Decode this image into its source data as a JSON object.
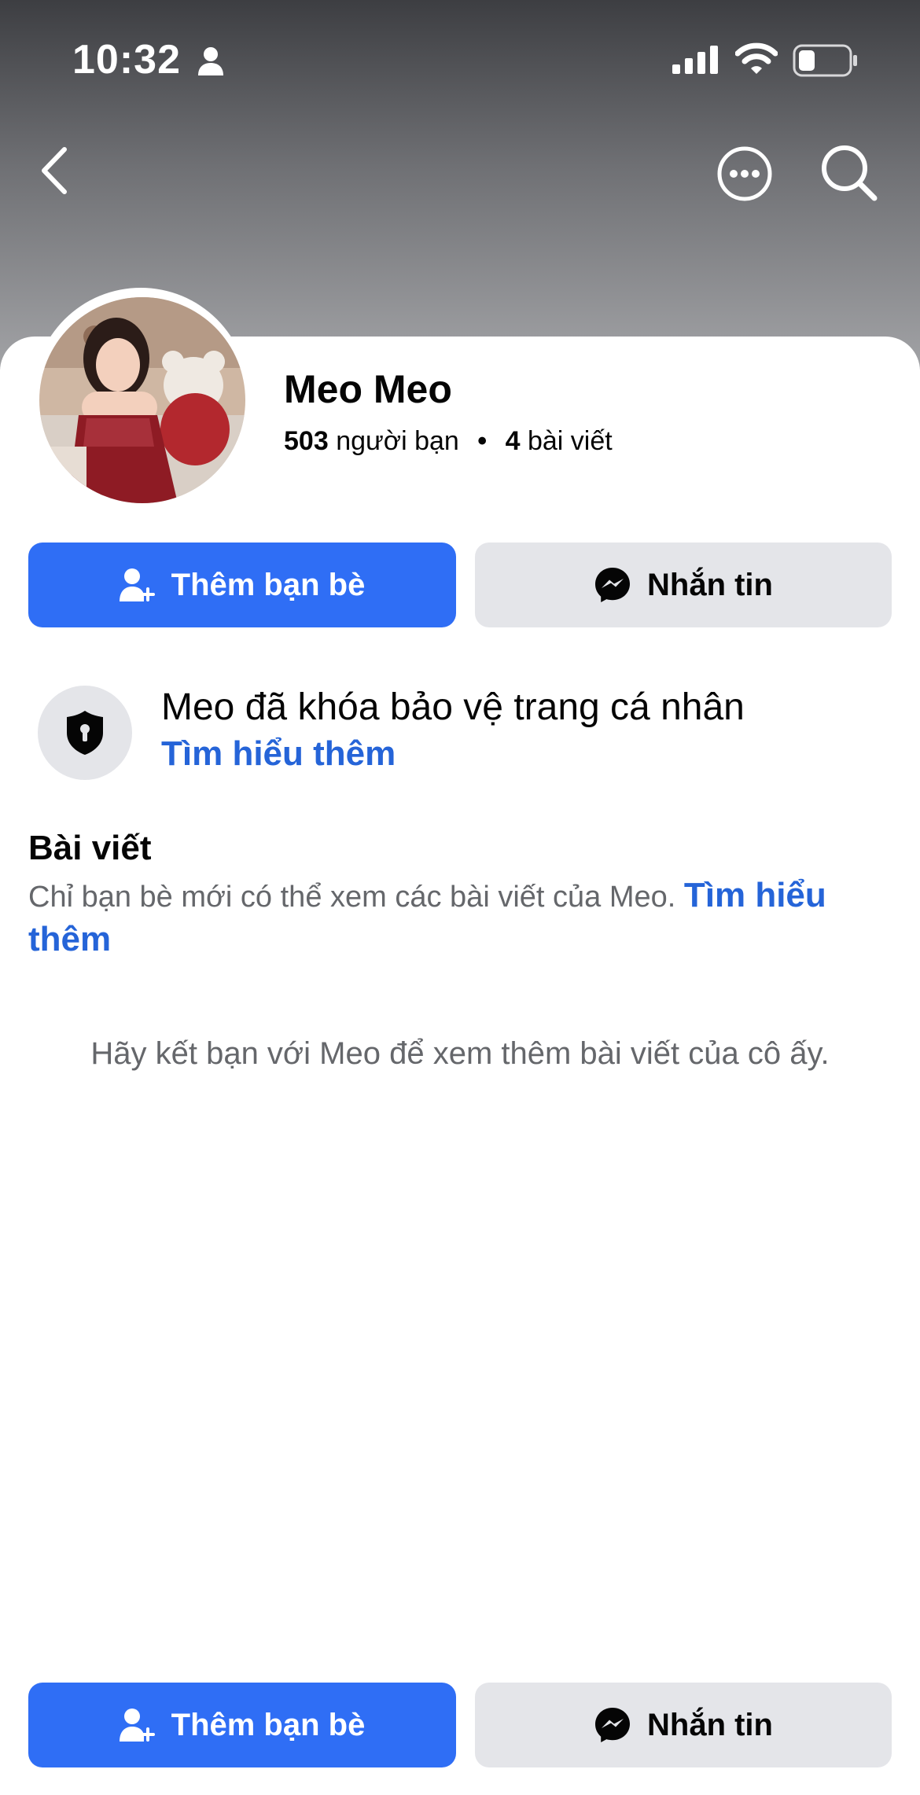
{
  "status_bar": {
    "time": "10:32",
    "icons": [
      "person-icon",
      "cellular-signal-icon",
      "wifi-icon",
      "battery-icon"
    ]
  },
  "nav": {
    "back_icon": "chevron-left-icon",
    "more_icon": "more-options-icon",
    "search_icon": "search-icon"
  },
  "profile": {
    "name": "Meo Meo",
    "friends_count": "503",
    "friends_label": "người bạn",
    "separator": "•",
    "posts_count": "4",
    "posts_label": "bài viết"
  },
  "actions": {
    "add_friend_label": "Thêm bạn bè",
    "message_label": "Nhắn tin"
  },
  "lock_notice": {
    "title": "Meo đã khóa bảo vệ trang cá nhân",
    "link": "Tìm hiểu thêm"
  },
  "posts_section": {
    "heading": "Bài viết",
    "description": "Chỉ bạn bè mới có thể xem các bài viết của Meo.",
    "link": "Tìm hiểu thêm",
    "empty_message": "Hãy kết bạn với Meo để xem thêm bài viết của cô ấy."
  },
  "colors": {
    "primary_blue": "#2f6ef5",
    "link_blue": "#2564d8",
    "secondary_gray": "#e4e5e9",
    "muted_text": "#65676b"
  }
}
